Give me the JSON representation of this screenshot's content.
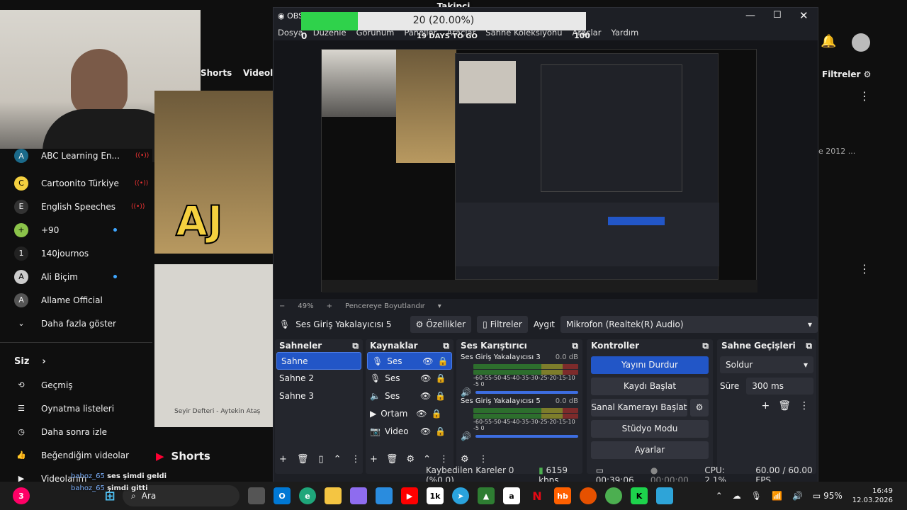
{
  "overlay": {
    "title": "Takipçi",
    "progress_text": "20 (20.00%)",
    "progress": 0.2,
    "min": "0",
    "max": "100",
    "subtitle": "19 DAYS TO GO"
  },
  "obs": {
    "app_title": "OBS",
    "menu": [
      "Dosya",
      "Düzenle",
      "Görünüm",
      "Paneller",
      "Araçlar",
      "Sahne Koleksiyonu",
      "Araçlar",
      "Yardım"
    ],
    "zoom": "49%",
    "fit_label": "Pencereye Boyutlandır",
    "source_name": "Ses Giriş Yakalayıcısı 5",
    "properties_label": "Özellikler",
    "filters_label": "Filtreler",
    "device_label": "Aygıt",
    "device_value": "Mikrofon (Realtek(R) Audio)",
    "scenes": {
      "title": "Sahneler",
      "items": [
        "Sahne",
        "Sahne 2",
        "Sahne 3"
      ]
    },
    "sources": {
      "title": "Kaynaklar",
      "items": [
        "Ses Giri:",
        "Ses Giri:",
        "Ses Çıkı",
        "Ortam F",
        "Video Y"
      ]
    },
    "mixer": {
      "title": "Ses Karıştırıcı",
      "tracks": [
        {
          "name": "Ses Giriş Yakalayıcısı 3",
          "db": "0.0 dB"
        },
        {
          "name": "Ses Giriş Yakalayıcısı 5",
          "db": "0.0 dB"
        }
      ],
      "scale": "-60-55-50-45-40-35-30-25-20-15-10 -5 0"
    },
    "controls": {
      "title": "Kontroller",
      "buttons": [
        "Yayını Durdur",
        "Kaydı Başlat",
        "Sanal Kamerayı Başlat",
        "Stüdyo Modu",
        "Ayarlar"
      ]
    },
    "transitions": {
      "title": "Sahne Geçişleri",
      "type": "Soldur",
      "duration_label": "Süre",
      "duration": "300 ms"
    },
    "status": {
      "dropped": "Kaybedilen Kareler 0 (%0.0)",
      "bitrate": "6159 kbps",
      "live_time": "00:39:06",
      "rec_time": "00:00:00",
      "cpu": "CPU: 2.1%",
      "fps": "60.00 / 60.00 FPS"
    }
  },
  "youtube": {
    "chips": [
      "Shorts",
      "Videolar"
    ],
    "filters": "Filtreler",
    "date_text": "e 2012 ...",
    "subs": [
      {
        "name": "ABC Learning En...",
        "live": true
      },
      {
        "name": "Cartoonito Türkiye",
        "live": true
      },
      {
        "name": "English Speeches",
        "live": true
      },
      {
        "name": "+90",
        "dot": true
      },
      {
        "name": "140journos"
      },
      {
        "name": "Ali Biçim",
        "dot": true
      },
      {
        "name": "Allame Official"
      }
    ],
    "more": "Daha fazla göster",
    "you": "Siz",
    "you_items": [
      "Geçmiş",
      "Oynatma listeleri",
      "Daha sonra izle",
      "Beğendiğim videolar",
      "Videolarım"
    ],
    "shorts_title": "Shorts",
    "thumb_text": "AJ",
    "thumb_caption": "Seyir Defteri - Aytekin Ataş"
  },
  "chat": [
    {
      "user": "bahoz_65",
      "msg": "ses şimdi geldi"
    },
    {
      "user": "bahoz_65",
      "msg": "şimdi gitti"
    }
  ],
  "taskbar": {
    "search": "Ara",
    "time": "16:49",
    "date": "12.03.2026",
    "battery": "95%",
    "notif": "3"
  }
}
